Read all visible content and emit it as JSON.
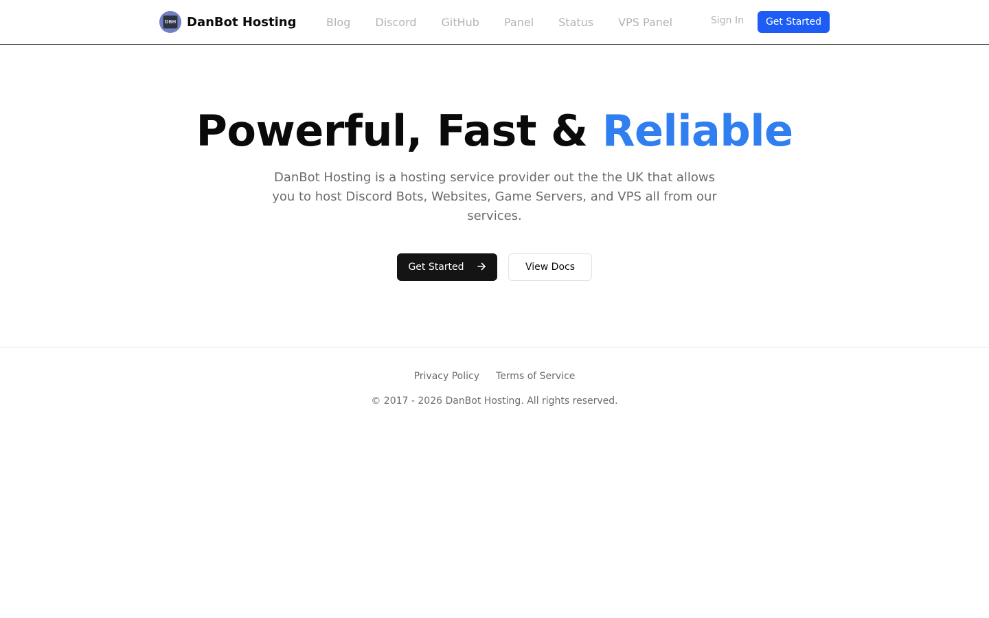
{
  "header": {
    "logo_text": "DBH",
    "brand_name": "DanBot Hosting",
    "nav": [
      {
        "label": "Blog"
      },
      {
        "label": "Discord"
      },
      {
        "label": "GitHub"
      },
      {
        "label": "Panel"
      },
      {
        "label": "Status"
      },
      {
        "label": "VPS Panel"
      }
    ],
    "sign_in_label": "Sign In",
    "get_started_label": "Get Started"
  },
  "hero": {
    "title_main": "Powerful, Fast & ",
    "title_accent": "Reliable",
    "description": "DanBot Hosting is a hosting service provider out the the UK that allows you to host Discord Bots, Websites, Game Servers, and VPS all from our services.",
    "primary_button_label": "Get Started",
    "primary_button_icon": "arrow-right-icon",
    "secondary_button_label": "View Docs"
  },
  "footer": {
    "links": [
      {
        "label": "Privacy Policy"
      },
      {
        "label": "Terms of Service"
      }
    ],
    "copyright": "© 2017 - 2026 DanBot Hosting. All rights reserved."
  },
  "colors": {
    "accent": "#1d5cf5",
    "accent_gradient_start": "#3b8cf0",
    "primary_button": "#141414",
    "muted_text": "#6b6b6b",
    "nav_text": "#b3b3b3"
  }
}
